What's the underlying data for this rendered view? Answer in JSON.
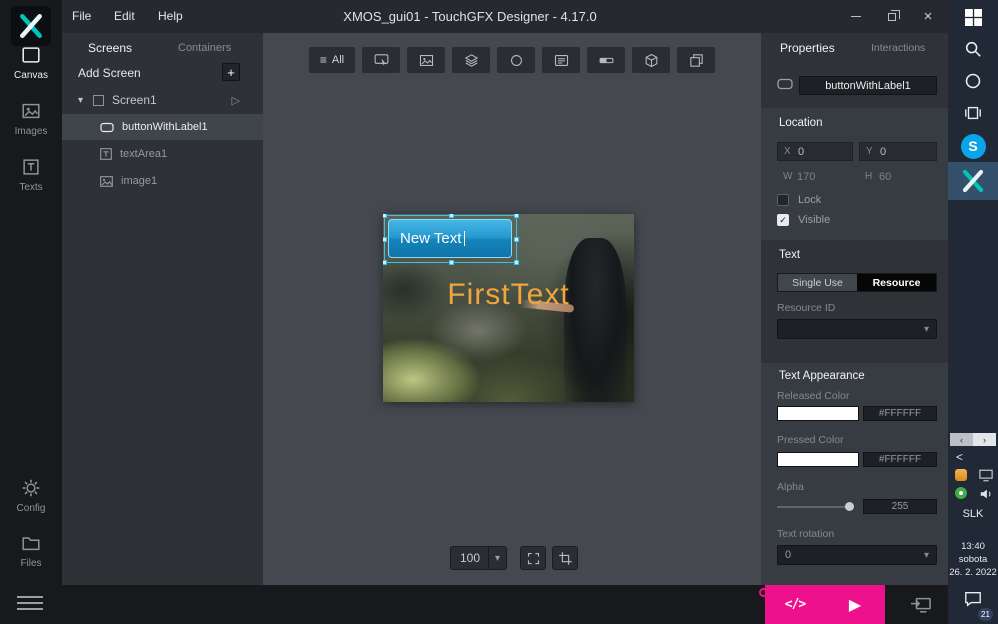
{
  "titlebar": {
    "menu": [
      {
        "label": "File"
      },
      {
        "label": "Edit"
      },
      {
        "label": "Help"
      }
    ],
    "title": "XMOS_gui01 - TouchGFX Designer - 4.17.0"
  },
  "activity_bar": {
    "items": [
      {
        "label": "Canvas"
      },
      {
        "label": "Images"
      },
      {
        "label": "Texts"
      }
    ],
    "bottom_items": [
      {
        "label": "Config"
      },
      {
        "label": "Files"
      }
    ]
  },
  "screens_panel": {
    "tab_screens": "Screens",
    "tab_containers": "Containers",
    "add_screen_label": "Add Screen",
    "screen": {
      "name": "Screen1"
    },
    "children": [
      {
        "label": "buttonWithLabel1"
      },
      {
        "label": "textArea1"
      },
      {
        "label": "image1"
      }
    ]
  },
  "canvas": {
    "toolbar_all_label": "All",
    "zoom_value": "100",
    "button_widget_text": "New Text",
    "textarea_widget_text": "FirstText"
  },
  "properties": {
    "tab_properties": "Properties",
    "tab_interactions": "Interactions",
    "name_value": "buttonWithLabel1",
    "location": {
      "title": "Location",
      "x_label": "X",
      "x_value": "0",
      "y_label": "Y",
      "y_value": "0",
      "w_label": "W",
      "w_value": "170",
      "h_label": "H",
      "h_value": "60",
      "lock_label": "Lock",
      "visible_label": "Visible"
    },
    "text": {
      "title": "Text",
      "single_use_label": "Single Use",
      "resource_label": "Resource",
      "resource_id_label": "Resource ID",
      "resource_id_value": ""
    },
    "appearance": {
      "title": "Text Appearance",
      "released_color_label": "Released Color",
      "released_color_value": "#FFFFFF",
      "pressed_color_label": "Pressed Color",
      "pressed_color_value": "#FFFFFF",
      "alpha_label": "Alpha",
      "alpha_value": "255",
      "rotation_label": "Text rotation",
      "rotation_value": "0"
    }
  },
  "taskbar": {
    "skype_letter": "S",
    "language": "SLK",
    "clock": {
      "time": "13:40",
      "day": "sobota",
      "date": "26. 2. 2022"
    },
    "notification_count": "21"
  },
  "icons": {
    "menu": "≡",
    "plus": "+",
    "caret_down": "▾",
    "play_outline": "▷",
    "chevron_down": "▾",
    "close": "×",
    "check": "✓",
    "code": "</>",
    "play": "▶",
    "angle_left": "‹",
    "angle_right": "›",
    "tray_expand": "<"
  },
  "colors": {
    "accent_teal": "#00c4ba",
    "run_pink": "#ed118c",
    "selection_cyan": "#38c2f2",
    "canvas_button_blue": "#1e9ad0",
    "canvas_text_orange": "#f0a53e",
    "skype_blue": "#0aa4e8",
    "released_color": "#FFFFFF",
    "pressed_color": "#FFFFFF"
  }
}
